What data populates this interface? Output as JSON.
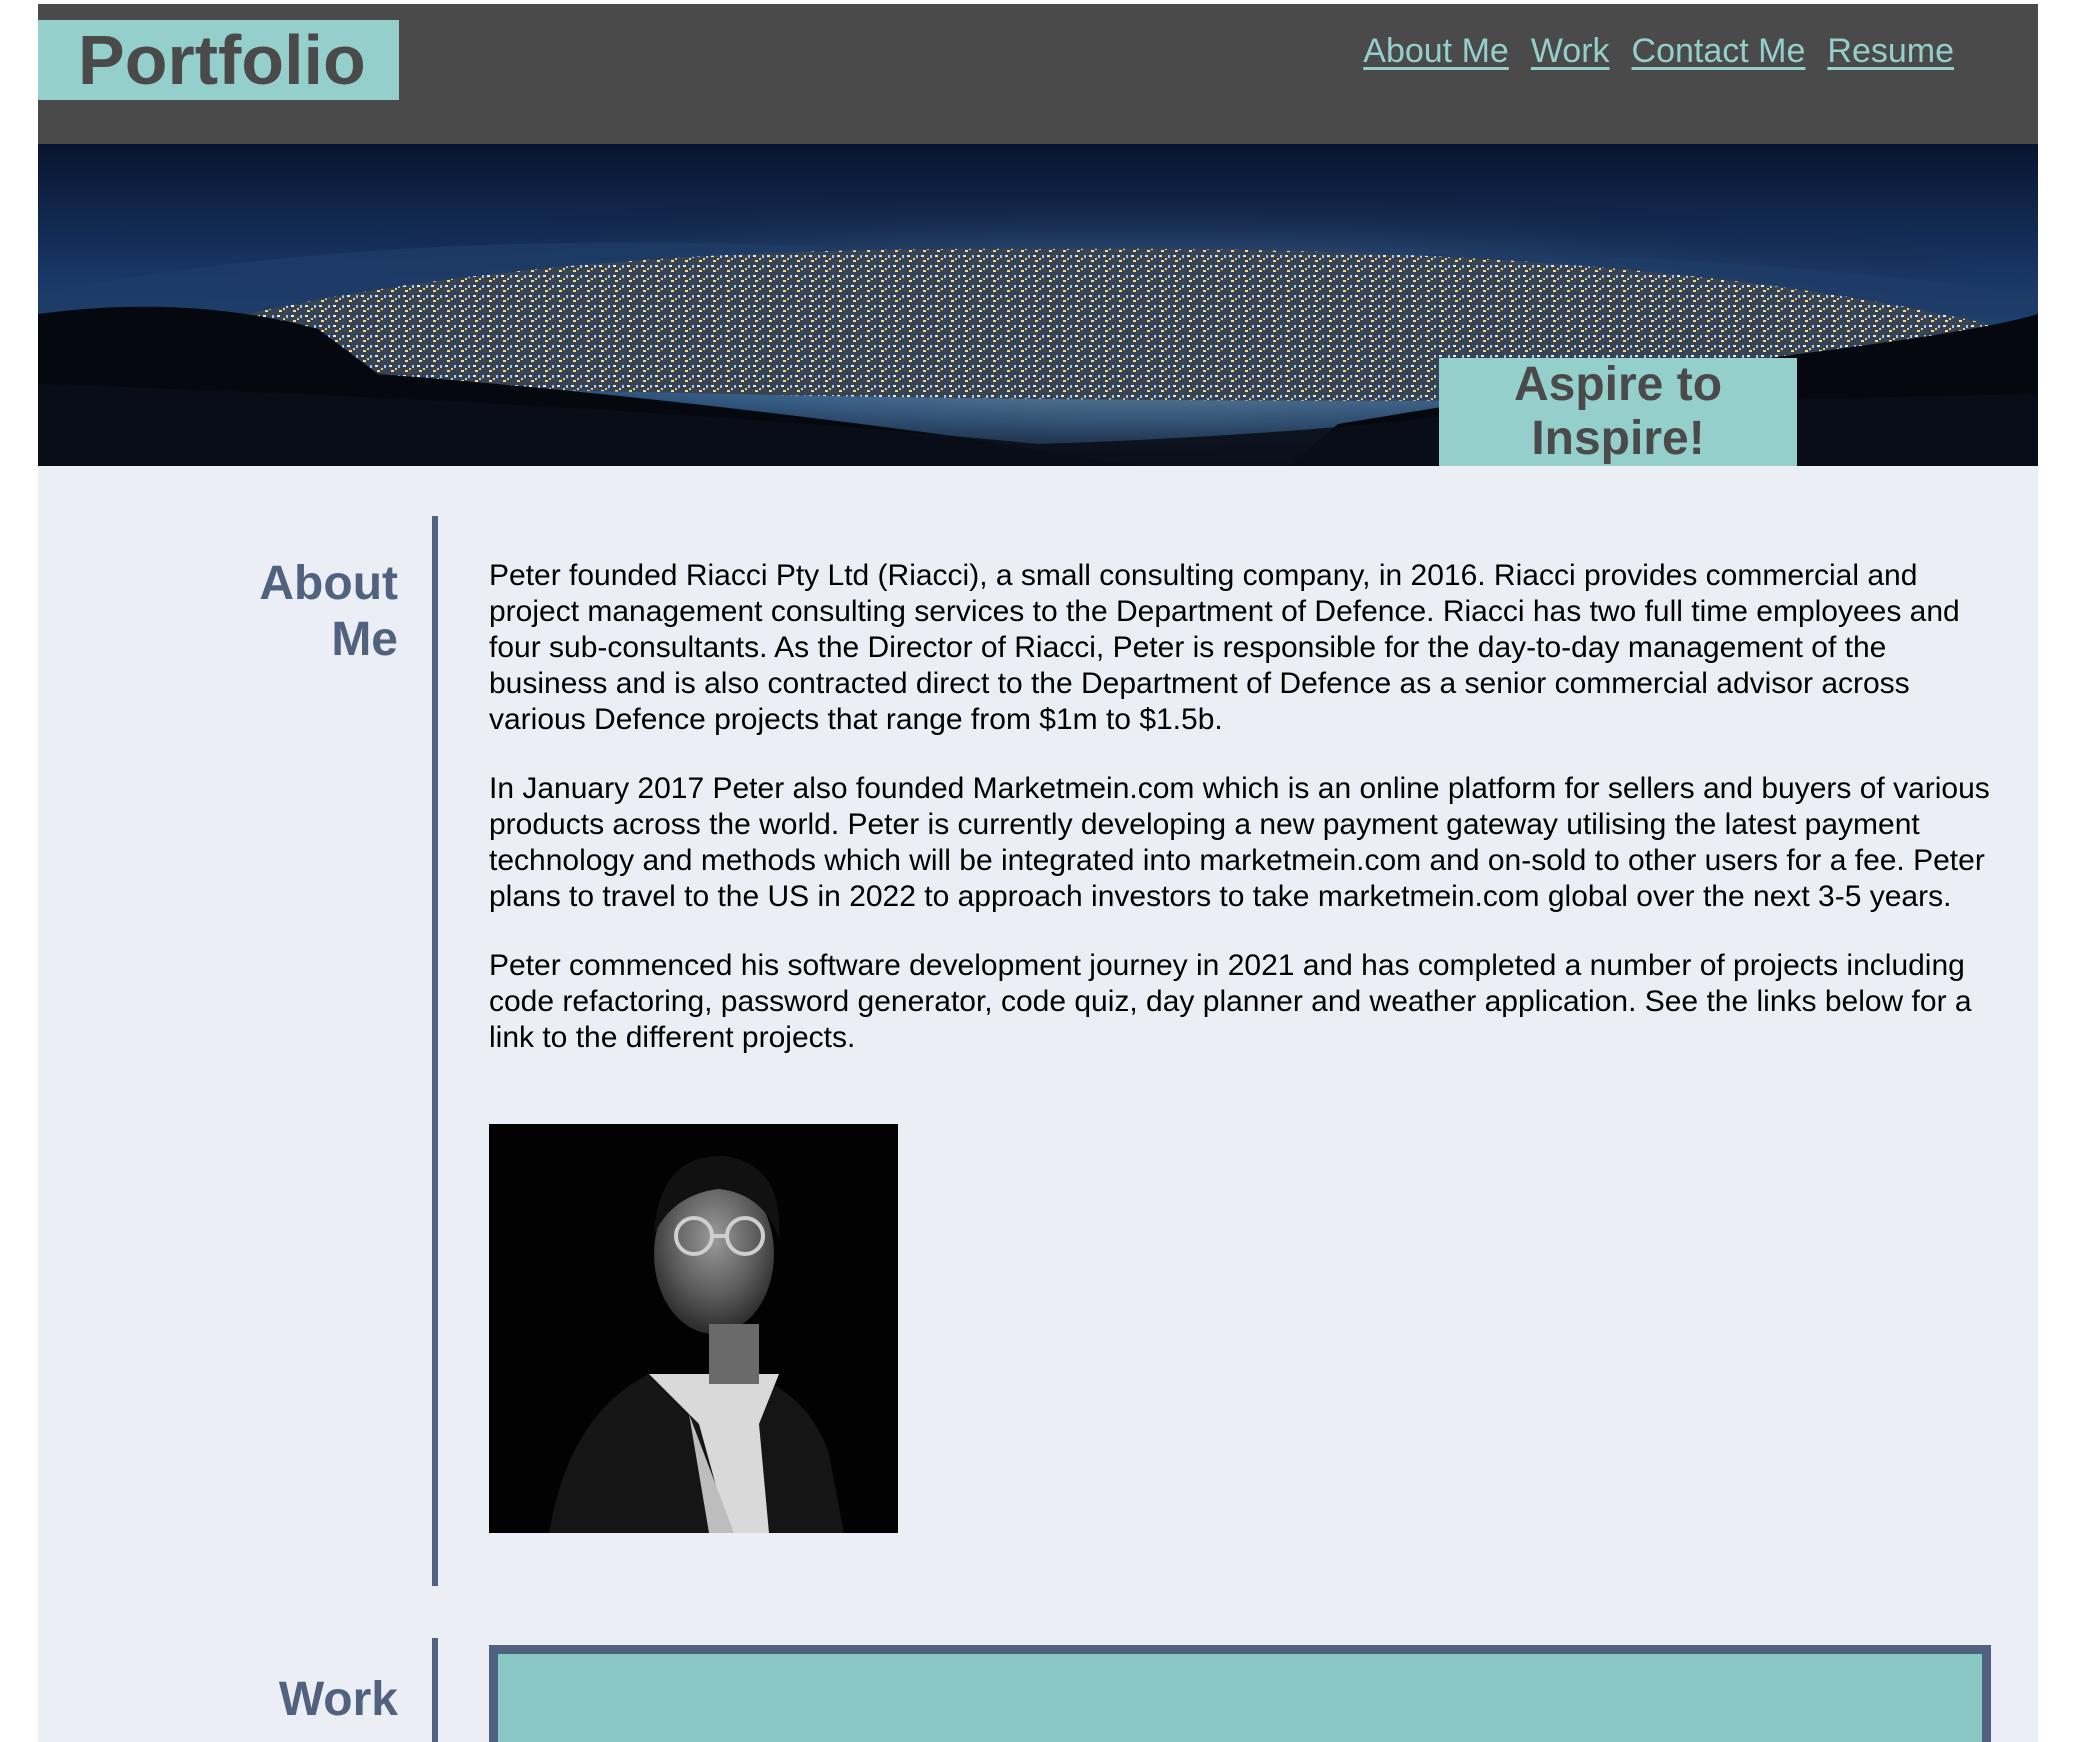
{
  "header": {
    "logo": "Portfolio",
    "nav": [
      "About Me",
      "Work",
      "Contact Me",
      "Resume"
    ]
  },
  "hero": {
    "tagline_line1": "Aspire to",
    "tagline_line2": "Inspire!"
  },
  "about": {
    "heading_line1": "About",
    "heading_line2": "Me",
    "paragraphs": [
      "Peter founded Riacci Pty Ltd (Riacci), a small consulting company, in 2016. Riacci provides commercial and project management consulting services to the Department of Defence. Riacci has two full time employees and four sub-consultants. As the Director of Riacci, Peter is responsible for the day-to-day management of the business and is also contracted direct to the Department of Defence as a senior commercial advisor across various Defence projects that range from $1m to $1.5b.",
      "In January 2017 Peter also founded Marketmein.com which is an online platform for sellers and buyers of various products across the world. Peter is currently developing a new payment gateway utilising the latest payment technology and methods which will be integrated into marketmein.com and on-sold to other users for a fee. Peter plans to travel to the US in 2022 to approach investors to take marketmein.com global over the next 3-5 years.",
      "Peter commenced his software development journey in 2021 and has completed a number of projects including code refactoring, password generator, code quiz, day planner and weather application. See the links below for a link to the different projects."
    ]
  },
  "work": {
    "heading": "Work"
  },
  "colors": {
    "header_bg": "#4a4a4a",
    "accent": "#94cfcc",
    "page_bg": "#eceef5",
    "heading": "#51627e"
  }
}
